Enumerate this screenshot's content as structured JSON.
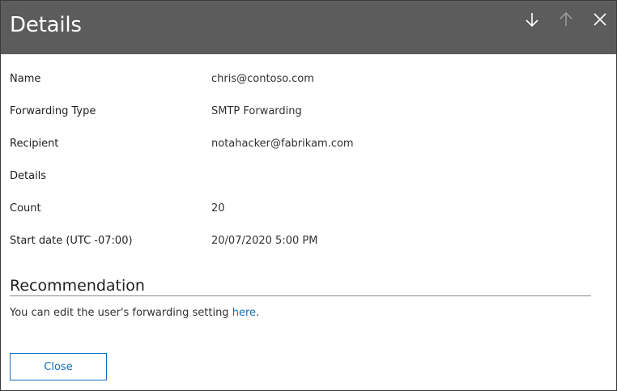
{
  "header": {
    "title": "Details",
    "next_icon": "arrow-down-icon",
    "previous_icon": "arrow-up-icon",
    "close_icon": "close-icon"
  },
  "details": {
    "name_label": "Name",
    "name_value": "chris@contoso.com",
    "forwarding_type_label": "Forwarding Type",
    "forwarding_type_value": "SMTP Forwarding",
    "recipient_label": "Recipient",
    "recipient_value": "notahacker@fabrikam.com",
    "details_label": "Details",
    "details_value": "",
    "count_label": "Count",
    "count_value": "20",
    "start_date_label": "Start date (UTC -07:00)",
    "start_date_value": "20/07/2020 5:00 PM"
  },
  "recommendation": {
    "title": "Recommendation",
    "text_before": "You can edit the user's forwarding setting ",
    "link_text": "here",
    "text_after": "."
  },
  "footer": {
    "close_label": "Close"
  },
  "colors": {
    "header_bg": "#5c5c5c",
    "accent": "#106ebe"
  }
}
